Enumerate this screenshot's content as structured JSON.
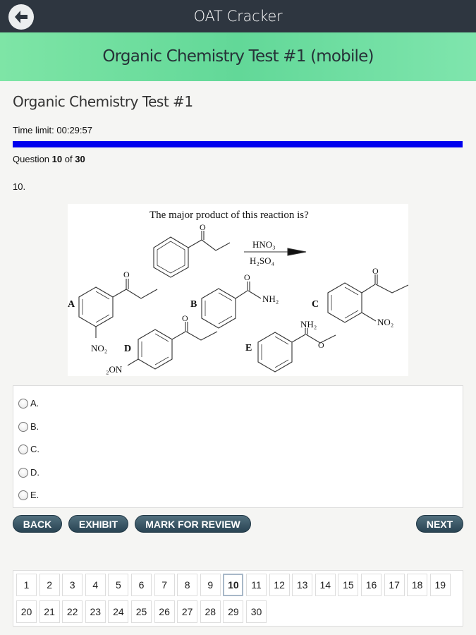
{
  "app": {
    "title": "OAT Cracker"
  },
  "banner": {
    "title": "Organic Chemistry Test #1 (mobile)"
  },
  "test": {
    "title": "Organic Chemistry Test #1",
    "time_limit_label": "Time limit:",
    "time_remaining": "00:29:57",
    "progress_fraction": 1.0,
    "question_word": "Question",
    "current_question": "10",
    "of_word": "of",
    "total_questions": "30",
    "question_number_label": "10."
  },
  "question": {
    "prompt": "The major product of this reaction is?",
    "reagent_top": "HNO₃",
    "reagent_bottom": "H₂SO₄",
    "choice_letters": [
      "A",
      "B",
      "C",
      "D",
      "E"
    ],
    "groups": {
      "no2": "NO₂",
      "nh2": "NH₂",
      "nh2_b": "NH₂",
      "no2_c": "NO₂",
      "o2n": "₂ON",
      "o": "O"
    }
  },
  "options": [
    "A.",
    "B.",
    "C.",
    "D.",
    "E."
  ],
  "buttons": {
    "back": "BACK",
    "exhibit": "EXHIBIT",
    "mark": "MARK FOR REVIEW",
    "next": "NEXT"
  },
  "pager": {
    "pages": [
      "1",
      "2",
      "3",
      "4",
      "5",
      "6",
      "7",
      "8",
      "9",
      "10",
      "11",
      "12",
      "13",
      "14",
      "15",
      "16",
      "17",
      "18",
      "19",
      "20",
      "21",
      "22",
      "23",
      "24",
      "25",
      "26",
      "27",
      "28",
      "29",
      "30"
    ],
    "current": "10"
  },
  "colors": {
    "appbar": "#2e3640",
    "banner": "#62d898",
    "progress": "#0000ee",
    "button": "#294453"
  }
}
